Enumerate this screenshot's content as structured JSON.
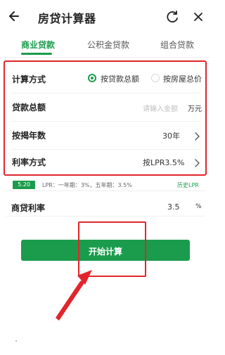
{
  "header": {
    "title": "房贷计算器",
    "back_icon": "back-arrow-icon",
    "refresh_icon": "refresh-icon",
    "close_icon": "close-icon"
  },
  "tabs": [
    {
      "label": "商业贷款",
      "active": true
    },
    {
      "label": "公积金贷款",
      "active": false
    },
    {
      "label": "组合贷款",
      "active": false
    }
  ],
  "form": {
    "calc_method": {
      "label": "计算方式",
      "options": [
        {
          "label": "按贷款总额",
          "selected": true
        },
        {
          "label": "按房屋总价",
          "selected": false
        }
      ]
    },
    "loan_amount": {
      "label": "贷款总额",
      "placeholder": "请输入金额",
      "unit": "万元"
    },
    "years": {
      "label": "按揭年数",
      "value": "30年"
    },
    "rate_method": {
      "label": "利率方式",
      "value": "按LPR3.5%"
    }
  },
  "lpr": {
    "date_badge": "5.20",
    "text": "LPR：一年期：3%，五年期：3.5%",
    "history_link": "历史LPR"
  },
  "commercial_rate": {
    "label": "商贷利率",
    "value": "3.5",
    "unit": "%"
  },
  "start_button": {
    "label": "开始计算"
  },
  "colors": {
    "accent": "#1a9c4c",
    "annotation_red": "#e0262c"
  }
}
